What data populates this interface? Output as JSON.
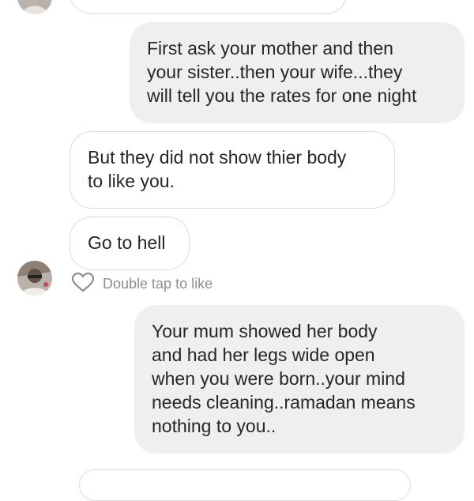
{
  "conversation": {
    "messages": [
      {
        "sender": "me",
        "lines": [
          "First ask your mother and then",
          "your sister..then your wife...they",
          "will tell you the rates for one night"
        ]
      },
      {
        "sender": "them",
        "lines": [
          "But they did not show thier body",
          "to like you."
        ]
      },
      {
        "sender": "them",
        "lines": [
          "Go to hell"
        ]
      },
      {
        "sender": "me",
        "lines": [
          "Your mum showed her body",
          "and had her legs wide open",
          "when you were born..your mind",
          "needs cleaning..ramadan means",
          "nothing to you.."
        ]
      }
    ],
    "like_prompt": "Double tap to like",
    "like_icon": "heart-outline-icon"
  },
  "colors": {
    "sent_bubble": "#efefef",
    "received_border": "#dbdbdb",
    "text": "#262626",
    "muted_text": "#8e8e8e"
  }
}
